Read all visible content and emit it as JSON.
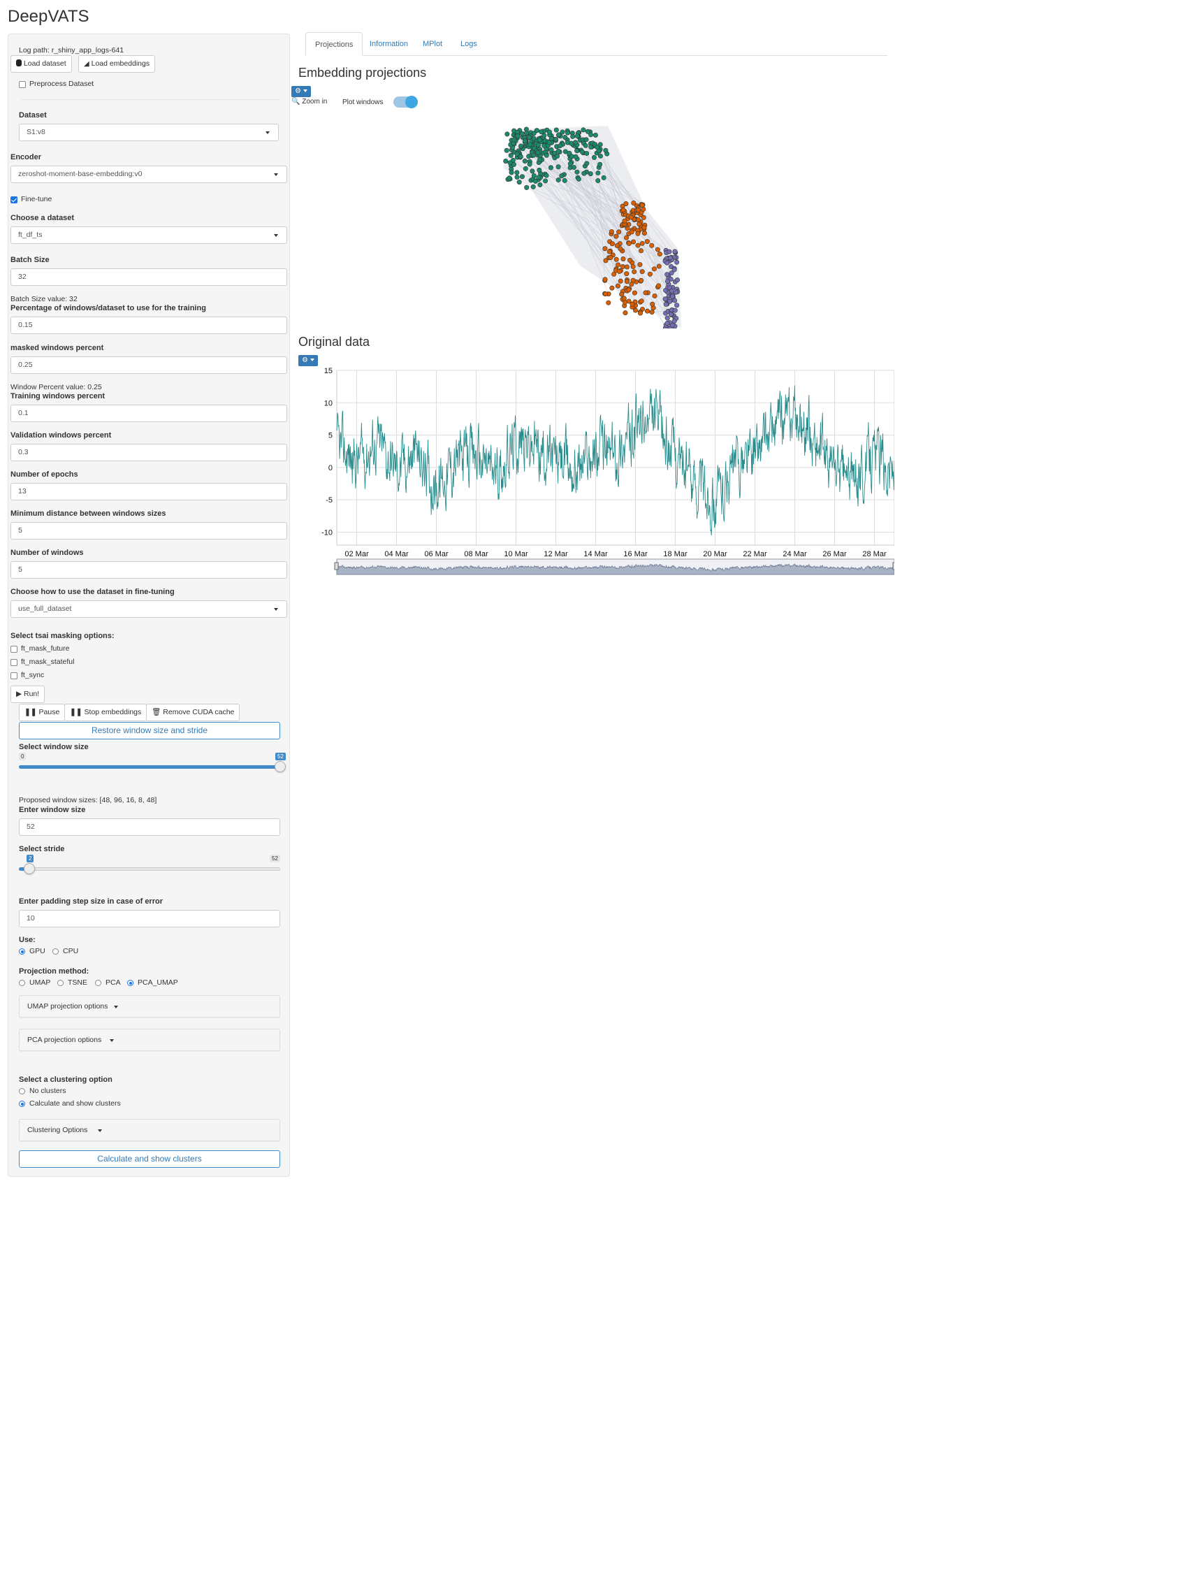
{
  "app": {
    "title": "DeepVATS"
  },
  "sidebar": {
    "log_path": "Log path: r_shiny_app_logs-641",
    "load_dataset": "Load dataset",
    "load_embeddings": "Load embeddings",
    "preprocess": "Preprocess Dataset",
    "dataset_label": "Dataset",
    "dataset_value": "S1:v8",
    "encoder_label": "Encoder",
    "encoder_value": "zeroshot-moment-base-embedding:v0",
    "finetune_label": "Fine-tune",
    "choose_dataset_label": "Choose a dataset",
    "choose_dataset_value": "ft_df_ts",
    "batch_size_label": "Batch Size",
    "batch_size_value": "32",
    "batch_size_text": "Batch Size value: 32",
    "pct_label": "Percentage of windows/dataset to use for the training",
    "pct_value": "0.15",
    "masked_label": "masked windows percent",
    "masked_value": "0.25",
    "window_pct_text": "Window Percent value: 0.25",
    "training_label": "Training windows percent",
    "training_value": "0.1",
    "validation_label": "Validation windows percent",
    "validation_value": "0.3",
    "epochs_label": "Number of epochs",
    "epochs_value": "13",
    "mindist_label": "Minimum distance between windows sizes",
    "mindist_value": "5",
    "nwindows_label": "Number of windows",
    "nwindows_value": "5",
    "howuse_label": "Choose how to use the dataset in fine-tuning",
    "howuse_value": "use_full_dataset",
    "tsai_label": "Select tsai masking options:",
    "tsai_options": [
      "ft_mask_future",
      "ft_mask_stateful",
      "ft_sync"
    ],
    "run": "Run!",
    "pause": "Pause",
    "stop": "Stop embeddings",
    "remove_cuda": "Remove CUDA cache",
    "restore": "Restore window size and stride",
    "select_ws_label": "Select window size",
    "ws_min": "0",
    "ws_badge": "52",
    "ws_fraction": 1.0,
    "proposed": "Proposed window sizes: [48, 96, 16, 8, 48]",
    "enter_ws_label": "Enter window size",
    "enter_ws_value": "52",
    "stride_label": "Select stride",
    "stride_badge": "2",
    "stride_max": "52",
    "stride_fraction": 0.04,
    "padding_label": "Enter padding step size in case of error",
    "padding_value": "10",
    "use_label": "Use:",
    "use_options": [
      "GPU",
      "CPU"
    ],
    "use_selected": "GPU",
    "proj_label": "Projection method:",
    "proj_options": [
      "UMAP",
      "TSNE",
      "PCA",
      "PCA_UMAP"
    ],
    "proj_selected": "PCA_UMAP",
    "umap_opts": "UMAP projection options",
    "pca_opts": "PCA projection options",
    "cluster_label": "Select a clustering option",
    "cluster_options": [
      "No clusters",
      "Calculate and show clusters"
    ],
    "cluster_selected": "Calculate and show clusters",
    "clustering_opts": "Clustering Options",
    "calc_button": "Calculate and show clusters"
  },
  "tabs": [
    "Projections",
    "Information",
    "MPlot",
    "Logs"
  ],
  "active_tab": "Projections",
  "projections": {
    "title": "Embedding projections",
    "zoom": "Zoom in",
    "plot_windows": "Plot windows",
    "plot_windows_on": true,
    "cluster_colors": [
      "#1b8a6b",
      "#d95f02",
      "#7570b3"
    ],
    "link_color": "#c9cad6"
  },
  "original": {
    "title": "Original data"
  },
  "chart_data": {
    "type": "line",
    "title": "",
    "xlabel": "",
    "ylabel": "",
    "x_tick_labels": [
      "02 Mar",
      "04 Mar",
      "06 Mar",
      "08 Mar",
      "10 Mar",
      "12 Mar",
      "14 Mar",
      "16 Mar",
      "18 Mar",
      "20 Mar",
      "22 Mar",
      "24 Mar",
      "26 Mar",
      "28 Mar"
    ],
    "y_ticks": [
      15,
      10,
      5,
      0,
      -5,
      -10
    ],
    "ylim": [
      -12,
      15
    ],
    "xlim": [
      "01 Mar",
      "29 Mar"
    ],
    "grid": true,
    "line_color": "#2a8c8c",
    "series_segments": [
      {
        "x": "01 Mar",
        "y": 3
      },
      {
        "x": "02 Mar",
        "y": 1
      },
      {
        "x": "03 Mar",
        "y": 4
      },
      {
        "x": "04 Mar",
        "y": 0
      },
      {
        "x": "05 Mar",
        "y": 2
      },
      {
        "x": "06 Mar",
        "y": -3
      },
      {
        "x": "07 Mar",
        "y": 1
      },
      {
        "x": "08 Mar",
        "y": 2
      },
      {
        "x": "09 Mar",
        "y": -1
      },
      {
        "x": "10 Mar",
        "y": 4
      },
      {
        "x": "11 Mar",
        "y": 3
      },
      {
        "x": "12 Mar",
        "y": 1
      },
      {
        "x": "13 Mar",
        "y": 0
      },
      {
        "x": "14 Mar",
        "y": 3
      },
      {
        "x": "15 Mar",
        "y": 2
      },
      {
        "x": "16 Mar",
        "y": 6
      },
      {
        "x": "17 Mar",
        "y": 7
      },
      {
        "x": "18 Mar",
        "y": 2
      },
      {
        "x": "19 Mar",
        "y": -2
      },
      {
        "x": "20 Mar",
        "y": -5
      },
      {
        "x": "21 Mar",
        "y": 0
      },
      {
        "x": "22 Mar",
        "y": 2
      },
      {
        "x": "23 Mar",
        "y": 6
      },
      {
        "x": "24 Mar",
        "y": 8
      },
      {
        "x": "25 Mar",
        "y": 4
      },
      {
        "x": "26 Mar",
        "y": 0
      },
      {
        "x": "27 Mar",
        "y": -2
      },
      {
        "x": "28 Mar",
        "y": 2
      },
      {
        "x": "29 Mar",
        "y": 0
      }
    ]
  }
}
